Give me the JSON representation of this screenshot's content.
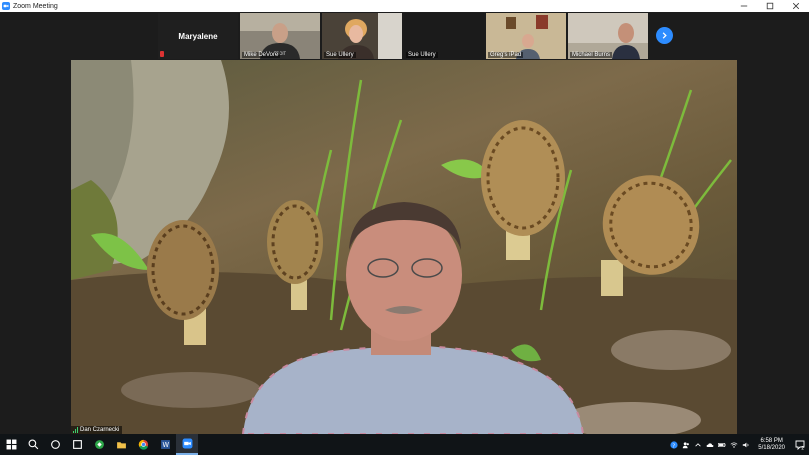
{
  "window": {
    "title": "Zoom Meeting",
    "controls": [
      "minimize-icon",
      "maximize-icon",
      "close-icon"
    ]
  },
  "gallery": {
    "participants": [
      {
        "name": "Maryalene",
        "video": false
      },
      {
        "name": "Mike DeVore",
        "video": true
      },
      {
        "name": "Sue Ullery",
        "video": true
      },
      {
        "name": "Sue Ullery",
        "video": false
      },
      {
        "name": "Greg's iPad",
        "video": true
      },
      {
        "name": "Michael Burns",
        "video": true
      }
    ],
    "next_icon": "chevron-right-icon"
  },
  "main": {
    "speaker_name": "Dan Czarnecki"
  },
  "taskbar": {
    "apps": [
      "windows-start-icon",
      "search-icon",
      "task-view-icon",
      "store-icon",
      "file-explorer-icon",
      "chrome-icon",
      "word-icon",
      "zoom-icon"
    ],
    "tray_icons": [
      "help-icon",
      "people-icon",
      "chevron-up-icon",
      "cloud-icon",
      "battery-icon",
      "wifi-icon",
      "volume-icon"
    ],
    "time": "6:58 PM",
    "date": "5/18/2020",
    "notification_count": "2"
  },
  "colors": {
    "zoom_blue": "#2d8cff",
    "meeting_bg": "#1c1c1c",
    "taskbar_bg": "#101417"
  }
}
